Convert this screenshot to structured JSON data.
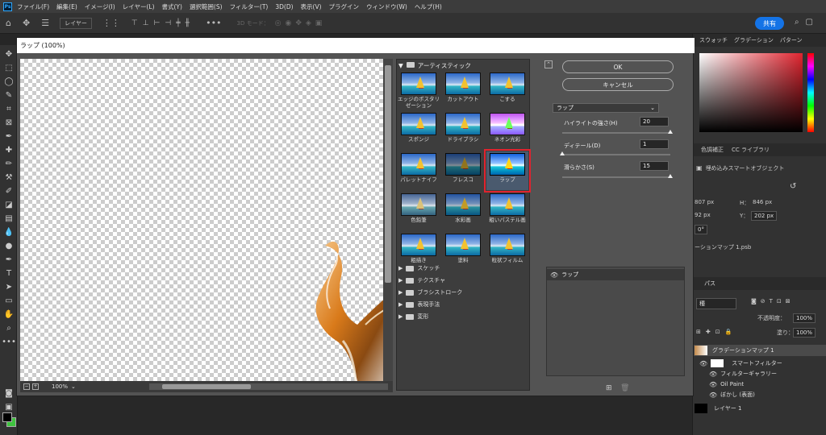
{
  "app": {
    "logo": "Ps"
  },
  "menu": [
    "ファイル(F)",
    "編集(E)",
    "イメージ(I)",
    "レイヤー(L)",
    "書式(Y)",
    "選択範囲(S)",
    "フィルター(T)",
    "3D(D)",
    "表示(V)",
    "プラグイン",
    "ウィンドウ(W)",
    "ヘルプ(H)"
  ],
  "options": {
    "layer_select": "レイヤー",
    "label_3d": "3D モード：",
    "share": "共有"
  },
  "right_panel": {
    "tabs": [
      "スウォッチ",
      "グラデーション",
      "パターン"
    ],
    "prop_tabs": [
      "色調補正",
      "CC ライブラリ"
    ],
    "smart_object": "埋め込みスマートオブジェクト",
    "w_val": "807 px",
    "h_label": "H：",
    "h_val": "846 px",
    "x_val": "92 px",
    "y_label": "Y：",
    "y_val": "202 px",
    "angle": "0°",
    "file": "ーションマップ 1.psb",
    "layers_tab": "パス",
    "kind": "種",
    "opacity_label": "不透明度：",
    "opacity": "100%",
    "fill_label": "塗り：",
    "fill": "100%",
    "layers": [
      "グラデーションマップ 1",
      "スマートフィルター",
      "フィルターギャラリー",
      "Oil Paint",
      "ぼかし (表面)",
      "レイヤー 1"
    ]
  },
  "dialog": {
    "title": "ラップ (100%)",
    "zoom": "100%",
    "gallery_header": "アーティスティック",
    "filters": [
      "エッジのポスタリゼーション",
      "カットアウト",
      "こする",
      "スポンジ",
      "ドライブラシ",
      "ネオン光彩",
      "パレットナイフ",
      "フレスコ",
      "ラップ",
      "色鉛筆",
      "水彩画",
      "粗いパステル画",
      "粗描き",
      "塗料",
      "粒状フィルム"
    ],
    "selected_filter": "ラップ",
    "categories": [
      "スケッチ",
      "テクスチャ",
      "ブラシストローク",
      "表現手法",
      "変形"
    ],
    "ok": "OK",
    "cancel": "キャンセル",
    "filter_select": "ラップ",
    "params": [
      {
        "label": "ハイライトの強さ(H)",
        "value": "20",
        "level": 1.0
      },
      {
        "label": "ディテール(D)",
        "value": "1",
        "level": 0.0
      },
      {
        "label": "滑らかさ(S)",
        "value": "15",
        "level": 1.0
      }
    ],
    "effect_layer": "ラップ"
  }
}
